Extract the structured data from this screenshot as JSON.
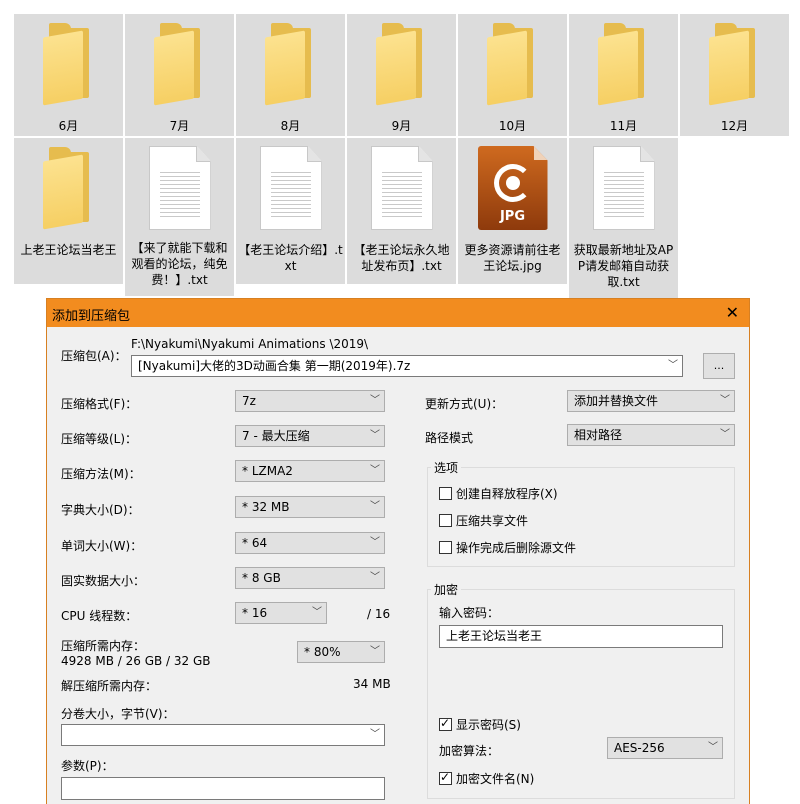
{
  "explorer": {
    "row1": [
      "6月",
      "7月",
      "8月",
      "9月",
      "10月",
      "11月",
      "12月"
    ],
    "row2": [
      {
        "label": "上老王论坛当老王",
        "icon": "folder-icon"
      },
      {
        "label": "【来了就能下载和观看的论坛，纯免费！】.txt",
        "icon": "text-file-icon"
      },
      {
        "label": "【老王论坛介绍】.txt",
        "icon": "text-file-icon"
      },
      {
        "label": "【老王论坛永久地址发布页】.txt",
        "icon": "text-file-icon"
      },
      {
        "label": "更多资源请前往老王论坛.jpg",
        "icon": "jpg-file-icon",
        "badge": "JPG"
      },
      {
        "label": "获取最新地址及APP请发邮箱自动获取.txt",
        "icon": "text-file-icon"
      }
    ]
  },
  "dialog": {
    "title": "添加到压缩包",
    "close": "✕",
    "archive": {
      "label": "压缩包(A)：",
      "path": "F:\\Nyakumi\\Nyakumi Animations \\2019\\",
      "value": "[Nyakumi]大佬的3D动画合集 第一期(2019年).7z",
      "browse": "..."
    },
    "left": {
      "format_label": "压缩格式(F)：",
      "format_value": "7z",
      "level_label": "压缩等级(L)：",
      "level_value": "7 - 最大压缩",
      "method_label": "压缩方法(M)：",
      "method_value": "* LZMA2",
      "dict_label": "字典大小(D)：",
      "dict_value": "* 32 MB",
      "word_label": "单词大小(W)：",
      "word_value": "* 64",
      "solid_label": "固实数据大小：",
      "solid_value": "* 8 GB",
      "cpu_label": "CPU 线程数：",
      "cpu_value": "* 16",
      "cpu_max": "/ 16",
      "mem_label": "压缩所需内存：",
      "mem_detail": "4928 MB / 26 GB / 32 GB",
      "mem_value": "* 80%",
      "decomp_label": "解压缩所需内存：",
      "decomp_value": "34 MB",
      "split_label": "分卷大小，字节(V)：",
      "split_value": "",
      "params_label": "参数(P)：",
      "params_value": ""
    },
    "right": {
      "update_label": "更新方式(U)：",
      "update_value": "添加并替换文件",
      "path_label": "路径模式",
      "path_value": "相对路径",
      "options_title": "选项",
      "opt_sfx": "创建自释放程序(X)",
      "opt_shared": "压缩共享文件",
      "opt_delete": "操作完成后删除源文件",
      "enc_title": "加密",
      "pwd_label": "输入密码：",
      "pwd_value": "上老王论坛当老王",
      "show_pwd": "显示密码(S)",
      "enc_method_label": "加密算法：",
      "enc_method_value": "AES-256",
      "enc_names": "加密文件名(N)"
    }
  }
}
